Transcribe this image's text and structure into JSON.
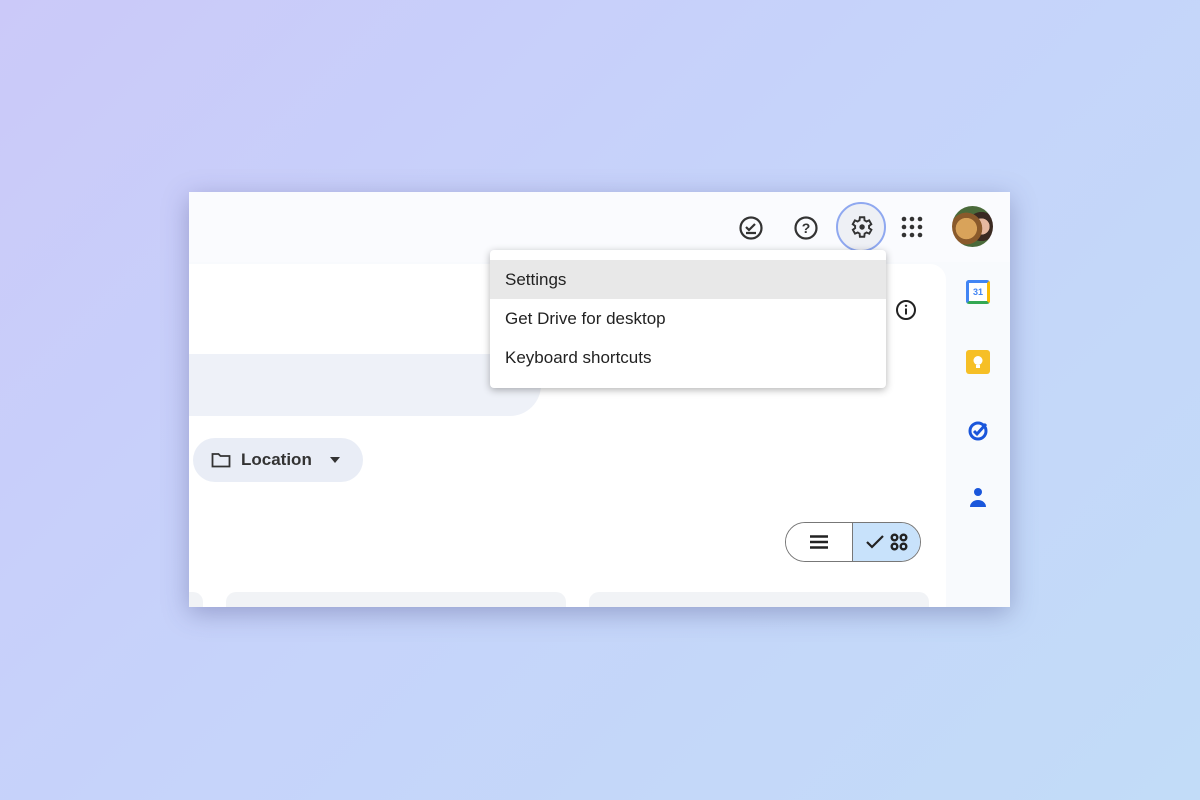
{
  "header": {
    "icons": [
      "offline-ready-icon",
      "help-icon",
      "settings-gear-icon",
      "apps-grid-icon",
      "avatar"
    ]
  },
  "menu": {
    "items": [
      {
        "label": "Settings",
        "highlighted": true
      },
      {
        "label": "Get Drive for desktop"
      },
      {
        "label": "Keyboard shortcuts"
      }
    ]
  },
  "filters": {
    "location_label": "Location"
  },
  "view_toggle": {
    "selected": "grid"
  },
  "side_panel": {
    "apps": [
      "calendar-icon",
      "keep-icon",
      "tasks-icon",
      "contacts-icon"
    ],
    "calendar_day": "31"
  },
  "colors": {
    "accent": "#8fa8f0",
    "selected_toggle": "#c8e2fb",
    "chip": "#e9edf6"
  }
}
